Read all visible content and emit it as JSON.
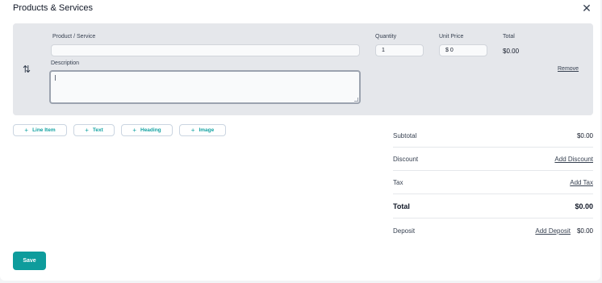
{
  "modal": {
    "title": "Products & Services",
    "close_icon": "close-icon"
  },
  "line_item": {
    "product_label": "Product / Service",
    "product_value": "",
    "quantity_label": "Quantity",
    "quantity_value": "1",
    "unit_price_label": "Unit Price",
    "unit_price_value": "$ 0",
    "total_label": "Total",
    "total_value": "$0.00",
    "description_label": "Description",
    "description_value": "",
    "remove_label": "Remove",
    "drag_icon": "reorder-arrows-icon"
  },
  "add_buttons": [
    {
      "label": "Line Item",
      "icon": "plus-icon"
    },
    {
      "label": "Text",
      "icon": "plus-icon"
    },
    {
      "label": "Heading",
      "icon": "plus-icon"
    },
    {
      "label": "Image",
      "icon": "plus-icon"
    }
  ],
  "summary": {
    "subtotal_label": "Subtotal",
    "subtotal_value": "$0.00",
    "discount_label": "Discount",
    "discount_link": "Add Discount",
    "tax_label": "Tax",
    "tax_link": "Add Tax",
    "total_label": "Total",
    "total_value": "$0.00",
    "deposit_label": "Deposit",
    "deposit_link": "Add Deposit",
    "deposit_value": "$0.00"
  },
  "footer": {
    "save_label": "Save"
  },
  "colors": {
    "accent": "#0e9c9c",
    "panel": "#e5e7eb"
  }
}
